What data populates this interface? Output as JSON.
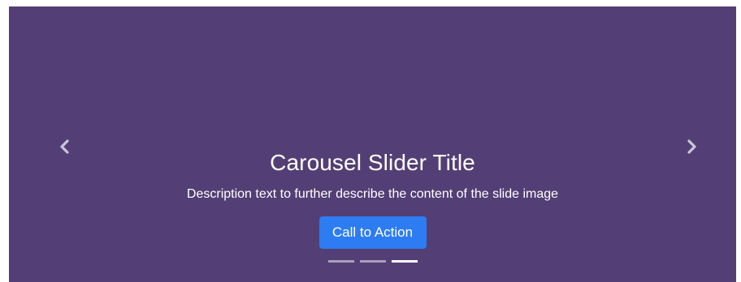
{
  "carousel": {
    "background_color": "#533f75",
    "prev_icon": "chevron-left-icon",
    "next_icon": "chevron-right-icon",
    "slide": {
      "title": "Carousel Slider Title",
      "description": "Description text to further describe the content of the slide image",
      "cta_label": "Call to Action",
      "cta_color": "#2d7cf2"
    },
    "indicators": {
      "count": 3,
      "active_index": 2
    }
  }
}
